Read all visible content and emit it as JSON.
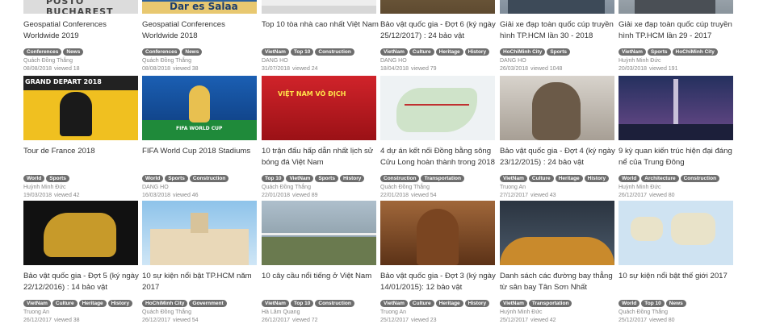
{
  "cards": [
    {
      "title": "Geospatial Conferences Worldwide 2019",
      "tags": [
        "Conferences",
        "News"
      ],
      "author": "Quách Đồng Thắng",
      "date": "08/08/2018",
      "views": "viewed 18",
      "thumb_text": "POSTO BUCHAREST"
    },
    {
      "title": "Geospatial Conferences Worldwide 2018",
      "tags": [
        "Conferences",
        "News"
      ],
      "author": "Quách Đồng Thắng",
      "date": "08/08/2018",
      "views": "viewed 38",
      "thumb_text": "Dar es Salaa"
    },
    {
      "title": "Top 10 tòa nhà cao nhất Việt Nam",
      "tags": [
        "VietNam",
        "Top 10",
        "Construction"
      ],
      "author": "DANG HO",
      "date": "31/07/2018",
      "views": "viewed 24",
      "thumb_text": ""
    },
    {
      "title": "Bảo vật quốc gia - Đợt 6 (ký ngày 25/12/2017) : 24 bảo vật",
      "tags": [
        "VietNam",
        "Culture",
        "Heritage",
        "History"
      ],
      "author": "DANG HO",
      "date": "18/04/2018",
      "views": "viewed 79",
      "thumb_text": ""
    },
    {
      "title": "Giải xe đạp toàn quốc cúp truyền hình TP.HCM lần 30 - 2018",
      "tags": [
        "HoChiMinh City",
        "Sports"
      ],
      "author": "DANG HO",
      "date": "26/03/2018",
      "views": "viewed 1048",
      "thumb_text": ""
    },
    {
      "title": "Giải xe đạp toàn quốc cúp truyền hình TP.HCM lần 29 - 2017",
      "tags": [
        "VietNam",
        "Sports",
        "HoChiMinh City"
      ],
      "author": "Huỳnh Minh Đức",
      "date": "20/03/2018",
      "views": "viewed 191",
      "thumb_text": ""
    },
    {
      "title": "Tour de France 2018",
      "tags": [
        "World",
        "Sports"
      ],
      "author": "Huỳnh Minh Đức",
      "date": "19/03/2018",
      "views": "viewed 42",
      "thumb_text": "GRAND DEPART 2018"
    },
    {
      "title": "FIFA World Cup 2018 Stadiums",
      "tags": [
        "World",
        "Sports",
        "Construction"
      ],
      "author": "DANG HO",
      "date": "16/03/2018",
      "views": "viewed 46",
      "thumb_text": "FIFA WORLD CUP"
    },
    {
      "title": "10 trận đấu hấp dẫn nhất lịch sử bóng đá Việt Nam",
      "tags": [
        "Top 10",
        "VietNam",
        "Sports",
        "History"
      ],
      "author": "Quách Đồng Thắng",
      "date": "22/01/2018",
      "views": "viewed 89",
      "thumb_text": "VIỆT NAM VÔ ĐỊCH"
    },
    {
      "title": "4 dự án kết nối Đồng bằng sông Cửu Long hoàn thành trong 2018",
      "tags": [
        "Construction",
        "Transportation"
      ],
      "author": "Quách Đồng Thắng",
      "date": "22/01/2018",
      "views": "viewed 54",
      "thumb_text": ""
    },
    {
      "title": "Bảo vật quốc gia - Đợt 4 (ký ngày 23/12/2015) : 24 bảo vật",
      "tags": [
        "VietNam",
        "Culture",
        "Heritage",
        "History"
      ],
      "author": "Truong An",
      "date": "27/12/2017",
      "views": "viewed 43",
      "thumb_text": ""
    },
    {
      "title": "9 kỳ quan kiến trúc hiện đại đáng nể của Trung Đông",
      "tags": [
        "World",
        "Architecture",
        "Construction"
      ],
      "author": "Huỳnh Minh Đức",
      "date": "26/12/2017",
      "views": "viewed 80",
      "thumb_text": ""
    },
    {
      "title": "Bảo vật quốc gia - Đợt 5 (ký ngày 22/12/2016) : 14 bảo vật",
      "tags": [
        "VietNam",
        "Culture",
        "Heritage",
        "History"
      ],
      "author": "Truong An",
      "date": "26/12/2017",
      "views": "viewed 38",
      "thumb_text": ""
    },
    {
      "title": "10 sự kiện nổi bật TP.HCM năm 2017",
      "tags": [
        "HoChiMinh City",
        "Government"
      ],
      "author": "Quách Đồng Thắng",
      "date": "26/12/2017",
      "views": "viewed 54",
      "thumb_text": ""
    },
    {
      "title": "10 cây cầu nổi tiếng ở Việt Nam",
      "tags": [
        "VietNam",
        "Top 10",
        "Construction"
      ],
      "author": "Hà Lâm Quang",
      "date": "26/12/2017",
      "views": "viewed 72",
      "thumb_text": ""
    },
    {
      "title": "Bảo vật quốc gia - Đợt 3 (ký ngày 14/01/2015): 12 bảo vật",
      "tags": [
        "VietNam",
        "Culture",
        "Heritage",
        "History"
      ],
      "author": "Truong An",
      "date": "25/12/2017",
      "views": "viewed 23",
      "thumb_text": ""
    },
    {
      "title": "Danh sách các đường bay thẳng từ sân bay Tân Sơn Nhất",
      "tags": [
        "VietNam",
        "Transportation"
      ],
      "author": "Huỳnh Minh Đức",
      "date": "25/12/2017",
      "views": "viewed 42",
      "thumb_text": ""
    },
    {
      "title": "10 sự kiện nổi bật thế giới 2017",
      "tags": [
        "World",
        "Top 10",
        "News"
      ],
      "author": "Quách Đồng Thắng",
      "date": "25/12/2017",
      "views": "viewed 80",
      "thumb_text": ""
    }
  ]
}
